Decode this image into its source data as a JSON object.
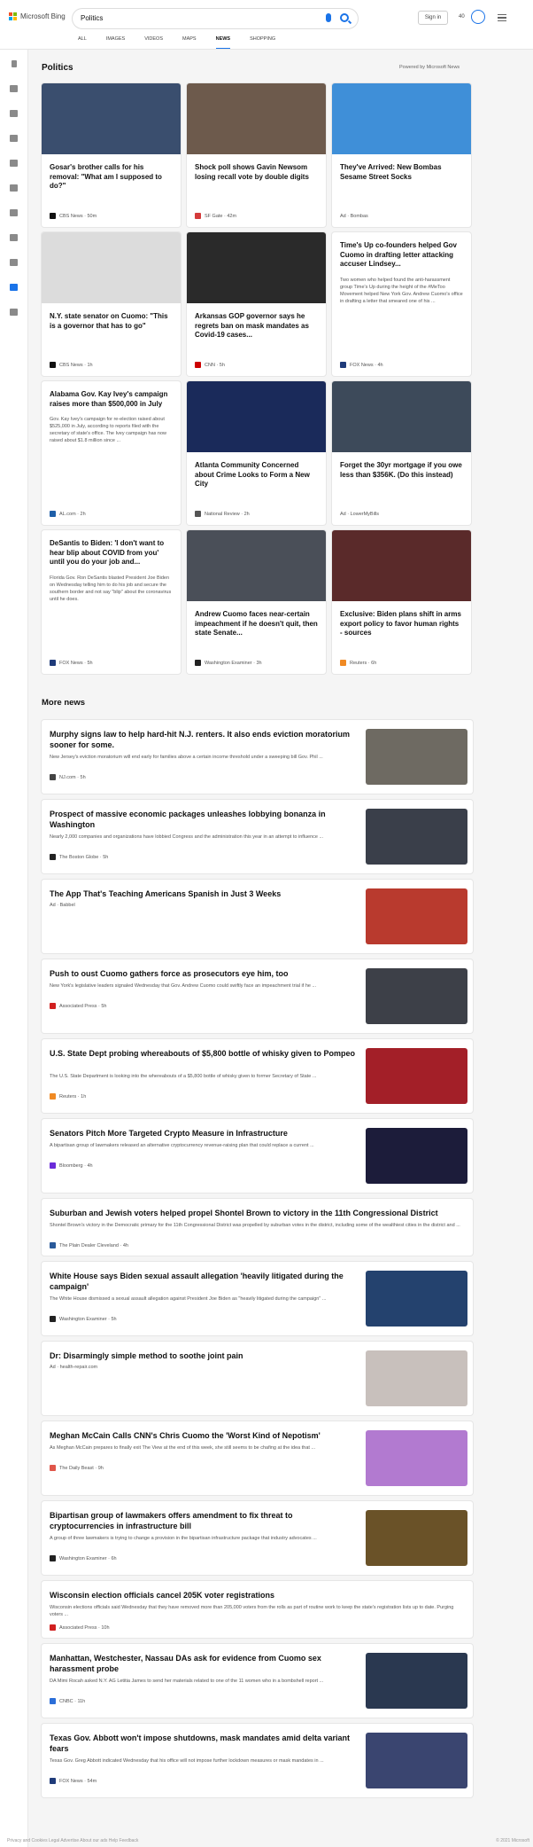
{
  "header": {
    "brand": "Microsoft Bing",
    "query": "Politics",
    "signin_label": "Sign in",
    "points": "40",
    "tabs": [
      {
        "label": "ALL"
      },
      {
        "label": "IMAGES"
      },
      {
        "label": "VIDEOS"
      },
      {
        "label": "MAPS"
      },
      {
        "label": "NEWS"
      },
      {
        "label": "SHOPPING"
      }
    ]
  },
  "politics": {
    "title": "Politics",
    "powered_by": "Powered by Microsoft News",
    "cards": [
      {
        "title": "Gosar's brother calls for his removal: \"What am I supposed to do?\"",
        "summary": "",
        "source": "CBS News · 50m",
        "image_color": "#3a4e6e",
        "favicon_color": "#111111"
      },
      {
        "title": "Shock poll shows Gavin Newsom losing recall vote by double digits",
        "summary": "",
        "source": "SF Gate · 42m",
        "image_color": "#6d5a4c",
        "favicon_color": "#d43b3b"
      },
      {
        "title": "They've Arrived: New Bombas Sesame Street Socks",
        "summary": "",
        "source": "Ad · Bombas",
        "image_color": "#3f8fd8",
        "favicon_color": "#ffffff"
      },
      {
        "title": "N.Y. state senator on Cuomo: \"This is a governor that has to go\"",
        "summary": "",
        "source": "CBS News · 1h",
        "image_color": "#dcdcdc",
        "favicon_color": "#111111"
      },
      {
        "title": "Arkansas GOP governor says he regrets ban on mask mandates as Covid-19 cases...",
        "summary": "",
        "source": "CNN · 5h",
        "image_color": "#2a2a2a",
        "favicon_color": "#cc0000"
      },
      {
        "title": "Time's Up co-founders helped Gov Cuomo in drafting letter attacking accuser Lindsey...",
        "summary": "Two women who helped found the anti-harassment group Time's Up during the height of the #MeToo Movement helped New York Gov. Andrew Cuomo's office in drafting a letter that smeared one of his ...",
        "source": "FOX News · 4h",
        "image_color": "",
        "favicon_color": "#1f3b7a"
      },
      {
        "title": "Alabama Gov. Kay Ivey's campaign raises more than $500,000 in July",
        "summary": "Gov. Kay Ivey's campaign for re-election raised about $525,000 in July, according to reports filed with the secretary of state's office. The Ivey campaign has now raised about $1.8 million since ...",
        "source": "AL.com · 2h",
        "image_color": "",
        "favicon_color": "#1f5fa8"
      },
      {
        "title": "Atlanta Community Concerned about Crime Looks to Form a New City",
        "summary": "",
        "source": "National Review · 2h",
        "image_color": "#1a2a5a",
        "favicon_color": "#555555"
      },
      {
        "title": "Forget the 30yr mortgage if you owe less than $356K. (Do this instead)",
        "summary": "",
        "source": "Ad · LowerMyBills",
        "image_color": "#3d4a5a",
        "favicon_color": "#ffffff"
      },
      {
        "title": "DeSantis to Biden: 'I don't want to hear blip about COVID from you' until you do your job and...",
        "summary": "Florida Gov. Ron DeSantis blasted President Joe Biden on Wednesday telling him to do his job and secure the southern border and not say \"blip\" about the coronavirus until he does.",
        "source": "FOX News · 5h",
        "image_color": "",
        "favicon_color": "#1f3b7a"
      },
      {
        "title": "Andrew Cuomo faces near-certain impeachment if he doesn't quit, then state Senate...",
        "summary": "",
        "source": "Washington Examiner · 3h",
        "image_color": "#4a4f58",
        "favicon_color": "#222222"
      },
      {
        "title": "Exclusive: Biden plans shift in arms export policy to favor human rights - sources",
        "summary": "",
        "source": "Reuters · 6h",
        "image_color": "#5a2a2a",
        "favicon_color": "#f08a24"
      }
    ]
  },
  "more_news": {
    "title": "More news",
    "items": [
      {
        "title": "Murphy signs law to help hard-hit N.J. renters. It also ends eviction moratorium sooner for some.",
        "summary": "New Jersey's eviction moratorium will end early for families above a certain income threshold under a sweeping bill Gov. Phil ...",
        "source": "NJ.com · 5h",
        "thumb_color": "#6e6a62",
        "favicon_color": "#444444"
      },
      {
        "title": "Prospect of massive economic packages unleashes lobbying bonanza in Washington",
        "summary": "Nearly 2,000 companies and organizations have lobbied Congress and the administration this year in an attempt to influence ...",
        "source": "The Boston Globe · 5h",
        "thumb_color": "#3a3f4a",
        "favicon_color": "#222222"
      },
      {
        "title": "The App That's Teaching Americans Spanish in Just 3 Weeks",
        "summary": "",
        "source": "Ad · Babbel",
        "thumb_color": "#b93a2e",
        "favicon_color": "#ffffff"
      },
      {
        "title": "Push to oust Cuomo gathers force as prosecutors eye him, too",
        "summary": "New York's legislative leaders signaled Wednesday that Gov. Andrew Cuomo could swiftly face an impeachment trial if he ...",
        "source": "Associated Press · 5h",
        "thumb_color": "#3d4048",
        "favicon_color": "#d12020"
      },
      {
        "title": "U.S. State Dept probing whereabouts of $5,800 bottle of whisky given to Pompeo",
        "summary": "The U.S. State Department is looking into the whereabouts of a $5,800 bottle of whisky given to former Secretary of State ...",
        "source": "Reuters · 1h",
        "thumb_color": "#a31f28",
        "favicon_color": "#f08a24"
      },
      {
        "title": "Senators Pitch More Targeted Crypto Measure in Infrastructure",
        "summary": "A bipartisan group of lawmakers released an alternative cryptocurrency revenue-raising plan that could replace a current ...",
        "source": "Bloomberg · 4h",
        "thumb_color": "#1c1c3a",
        "favicon_color": "#6a2bd9"
      },
      {
        "title": "Suburban and Jewish voters helped propel Shontel Brown to victory in the 11th Congressional District",
        "summary": "Shontel Brown's victory in the Democratic primary for the 11th Congressional District was propelled by suburban votes in the district, including some of the wealthiest cities in the district and ...",
        "source": "The Plain Dealer Cleveland · 4h",
        "thumb_color": "",
        "favicon_color": "#2a5a9a"
      },
      {
        "title": "White House says Biden sexual assault allegation 'heavily litigated during the campaign'",
        "summary": "The White House dismissed a sexual assault allegation against President Joe Biden as \"heavily litigated during the campaign\" ...",
        "source": "Washington Examiner · 5h",
        "thumb_color": "#24426e",
        "favicon_color": "#222222"
      },
      {
        "title": "Dr: Disarmingly simple method to soothe joint pain",
        "summary": "",
        "source": "Ad · health-repair.com",
        "thumb_color": "#c8c0bc",
        "favicon_color": "#ffffff"
      },
      {
        "title": "Meghan McCain Calls CNN's Chris Cuomo the 'Worst Kind of Nepotism'",
        "summary": "As Meghan McCain prepares to finally exit The View at the end of this week, she still seems to be chafing at the idea that ...",
        "source": "The Daily Beast · 9h",
        "thumb_color": "#b27ad0",
        "favicon_color": "#e0564a"
      },
      {
        "title": "Bipartisan group of lawmakers offers amendment to fix threat to cryptocurrencies in infrastructure bill",
        "summary": "A group of three lawmakers is trying to change a provision in the bipartisan infrastructure package that industry advocates ...",
        "source": "Washington Examiner · 6h",
        "thumb_color": "#6a5228",
        "favicon_color": "#222222"
      },
      {
        "title": "Wisconsin election officials cancel 205K voter registrations",
        "summary": "Wisconsin elections officials said Wednesday that they have removed more than 205,000 voters from the rolls as part of routine work to keep the state's registration lists up to date. Purging voters ...",
        "source": "Associated Press · 10h",
        "thumb_color": "",
        "favicon_color": "#d12020"
      },
      {
        "title": "Manhattan, Westchester, Nassau DAs ask for evidence from Cuomo sex harassment probe",
        "summary": "DA Mimi Rocah asked N.Y. AG Letitia James to send her materials related to one of the 11 women who in a bombshell report ...",
        "source": "CNBC · 11h",
        "thumb_color": "#2a3850",
        "favicon_color": "#2b6ed8"
      },
      {
        "title": "Texas Gov. Abbott won't impose shutdowns, mask mandates amid delta variant fears",
        "summary": "Texas Gov. Greg Abbott indicated Wednesday that his office will not impose further lockdown measures or mask mandates in ...",
        "source": "FOX News · 54m",
        "thumb_color": "#3a4570",
        "favicon_color": "#1f3b7a"
      }
    ]
  },
  "footer": {
    "left": "Privacy and Cookies   Legal   Advertise   About our ads   Help   Feedback",
    "right": "© 2021 Microsoft"
  },
  "colors": {
    "accent": "#1a73e8"
  }
}
